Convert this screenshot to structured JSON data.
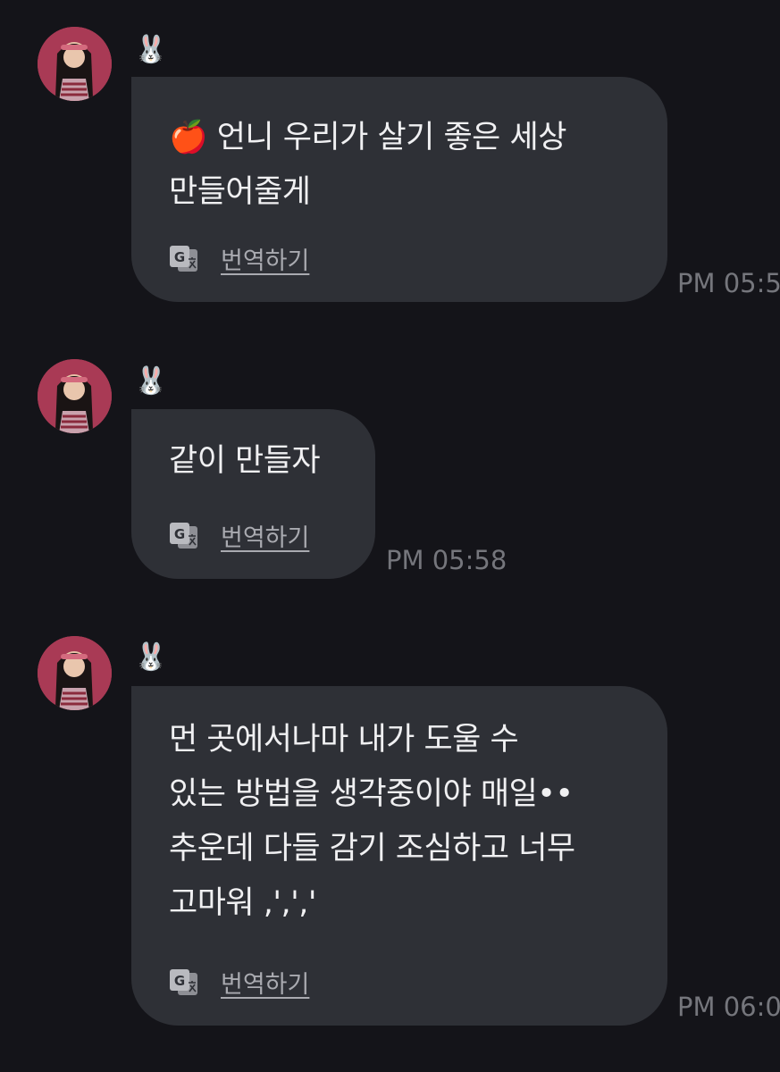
{
  "messages": [
    {
      "sender": "🐰",
      "text": "🍎 언니 우리가 살기 좋은 세상\n만들어줄게",
      "translate_label": "번역하기",
      "time": "PM 05:5"
    },
    {
      "sender": "🐰",
      "text": "같이 만들자",
      "translate_label": "번역하기",
      "time": "PM 05:58"
    },
    {
      "sender": "🐰",
      "text": "먼 곳에서나마 내가 도울 수\n있는 방법을 생각중이야 매일••\n추운데 다들 감기 조심하고 너무\n고마워 ,',',' ",
      "translate_label": "번역하기",
      "time": "PM 06:0"
    }
  ],
  "colors": {
    "background": "#141419",
    "bubble": "#2e3036",
    "timestamp": "#75767c",
    "link": "#a9aab0"
  },
  "icons": {
    "avatar": "profile-photo",
    "translate": "translate-icon"
  }
}
